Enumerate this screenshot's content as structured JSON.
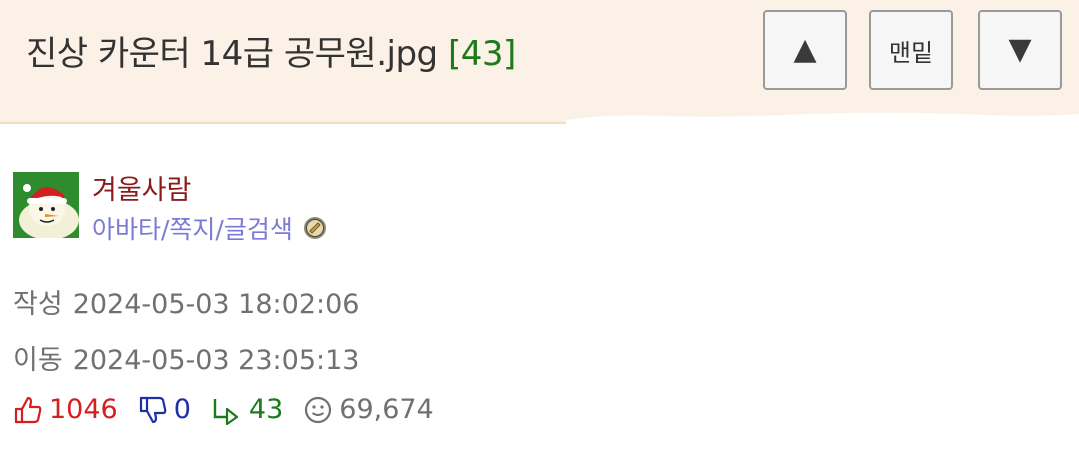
{
  "header": {
    "title": "진상 카운터 14급 공무원.jpg",
    "comment_count": "[43]",
    "buttons": {
      "up_icon": "triangle-up-icon",
      "bottom_label": "맨밑",
      "down_icon": "triangle-down-icon"
    }
  },
  "author": {
    "name": "겨울사람",
    "links": "아바타/쪽지/글검색",
    "badge_icon": "level-badge-icon",
    "avatar_icon": "snowman-santa-hat-avatar"
  },
  "meta": {
    "created_label": "작성",
    "created_value": "2024-05-03 18:02:06",
    "moved_label": "이동",
    "moved_value": "2024-05-03 23:05:13"
  },
  "stats": {
    "likes": "1046",
    "dislikes": "0",
    "replies": "43",
    "views": "69,674"
  },
  "colors": {
    "header_bg": "#fbf1e6",
    "author": "#8b1a1a",
    "links": "#7b7bd6",
    "likes": "#d21f1f",
    "dislikes": "#1e2fa8",
    "replies": "#1c7a1c"
  }
}
